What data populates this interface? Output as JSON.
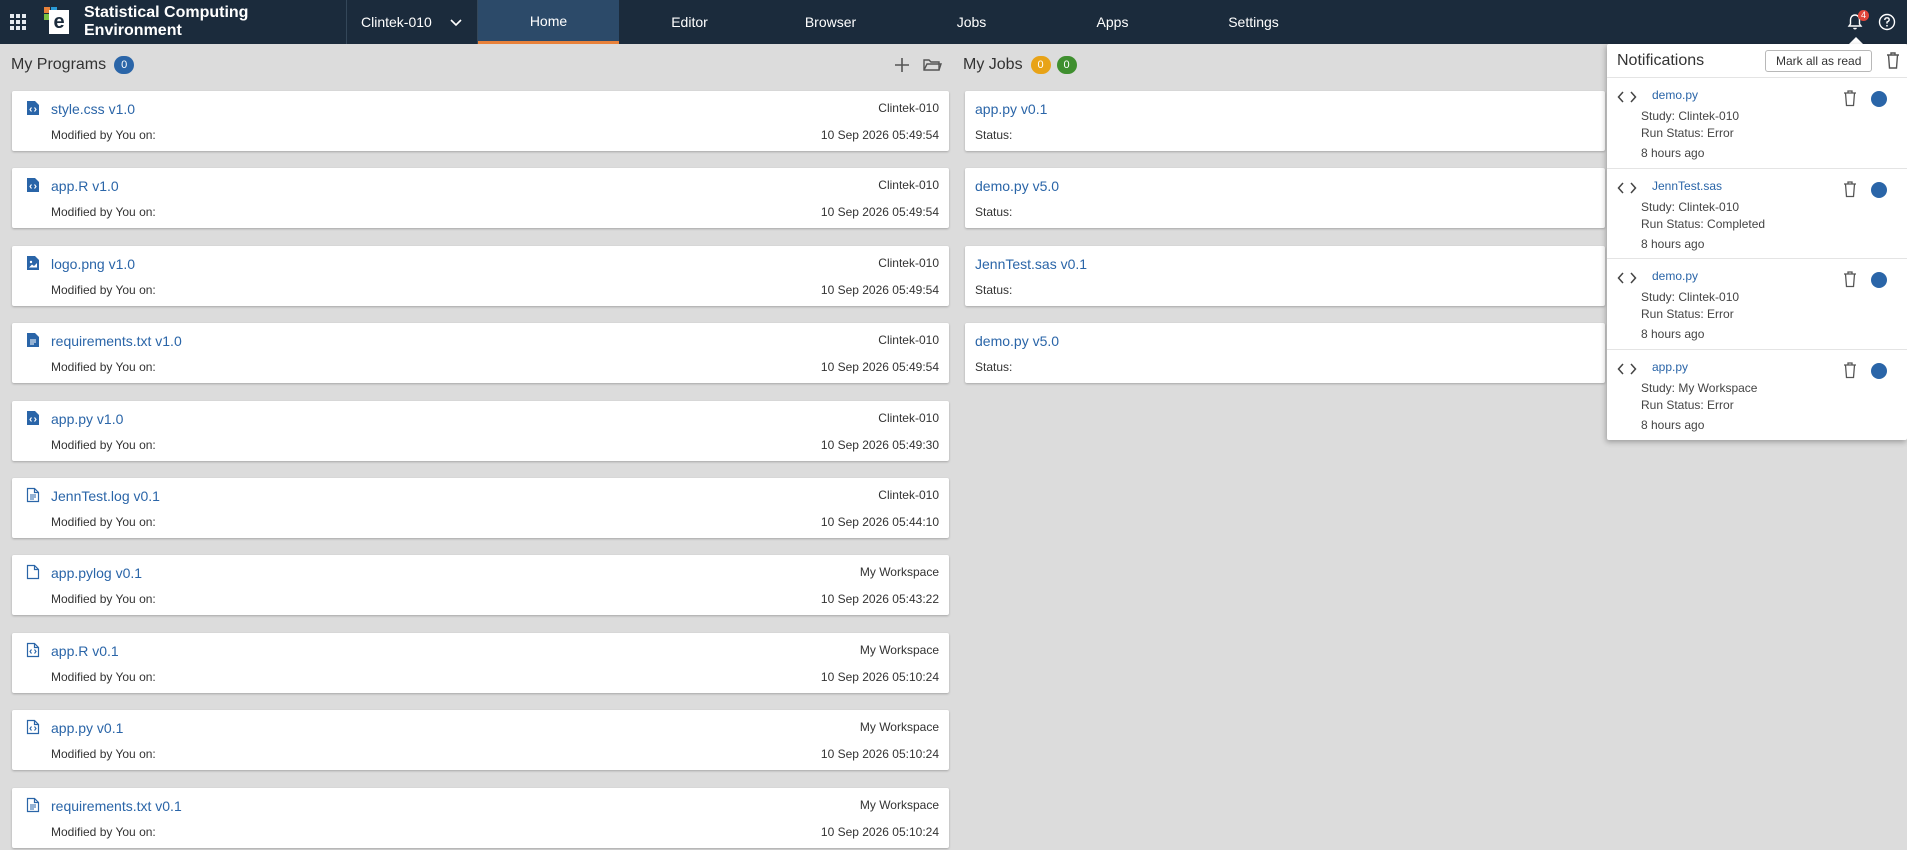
{
  "app": {
    "title": "Statistical Computing Environment",
    "logo_letter": "e",
    "study": "Clintek-010"
  },
  "nav": [
    {
      "label": "Home",
      "active": true
    },
    {
      "label": "Editor"
    },
    {
      "label": "Browser"
    },
    {
      "label": "Jobs"
    },
    {
      "label": "Apps"
    },
    {
      "label": "Settings"
    }
  ],
  "header_icons": {
    "notification_count": "4"
  },
  "programs": {
    "title": "My Programs",
    "count": "0",
    "count_color": "#2a65a8",
    "items": [
      {
        "name": "style.css v1.0",
        "icon": "code-file-icon",
        "study": "Clintek-010",
        "meta": "Modified by You on:",
        "date": "10 Sep 2026 05:49:54"
      },
      {
        "name": "app.R v1.0",
        "icon": "code-file-icon",
        "study": "Clintek-010",
        "meta": "Modified by You on:",
        "date": "10 Sep 2026 05:49:54"
      },
      {
        "name": "logo.png v1.0",
        "icon": "image-file-icon",
        "study": "Clintek-010",
        "meta": "Modified by You on:",
        "date": "10 Sep 2026 05:49:54"
      },
      {
        "name": "requirements.txt v1.0",
        "icon": "text-file-icon",
        "study": "Clintek-010",
        "meta": "Modified by You on:",
        "date": "10 Sep 2026 05:49:54"
      },
      {
        "name": "app.py v1.0",
        "icon": "code-file-icon",
        "study": "Clintek-010",
        "meta": "Modified by You on:",
        "date": "10 Sep 2026 05:49:30"
      },
      {
        "name": "JennTest.log v0.1",
        "icon": "text-file-outline-icon",
        "study": "Clintek-010",
        "meta": "Modified by You on:",
        "date": "10 Sep 2026 05:44:10"
      },
      {
        "name": "app.pylog v0.1",
        "icon": "blank-file-outline-icon",
        "study": "My Workspace",
        "meta": "Modified by You on:",
        "date": "10 Sep 2026 05:43:22"
      },
      {
        "name": "app.R v0.1",
        "icon": "code-file-outline-icon",
        "study": "My Workspace",
        "meta": "Modified by You on:",
        "date": "10 Sep 2026 05:10:24"
      },
      {
        "name": "app.py v0.1",
        "icon": "code-file-outline-icon",
        "study": "My Workspace",
        "meta": "Modified by You on:",
        "date": "10 Sep 2026 05:10:24"
      },
      {
        "name": "requirements.txt v0.1",
        "icon": "text-file-outline-icon",
        "study": "My Workspace",
        "meta": "Modified by You on:",
        "date": "10 Sep 2026 05:10:24"
      }
    ]
  },
  "jobs": {
    "title": "My Jobs",
    "count_a": "0",
    "count_a_color": "#e8a317",
    "count_b": "0",
    "count_b_color": "#3f8f2f",
    "items": [
      {
        "name": "app.py v0.1",
        "meta": "Status:"
      },
      {
        "name": "demo.py v5.0",
        "meta": "Status:"
      },
      {
        "name": "JennTest.sas v0.1",
        "meta": "Status:"
      },
      {
        "name": "demo.py v5.0",
        "meta": "Status:"
      }
    ]
  },
  "notifications": {
    "title": "Notifications",
    "mark_all_label": "Mark all as read",
    "dot_color": "#2a65a8",
    "items": [
      {
        "name": "demo.py",
        "study": "Study: Clintek-010",
        "status": "Run Status: Error",
        "time": "8 hours ago"
      },
      {
        "name": "JennTest.sas",
        "study": "Study: Clintek-010",
        "status": "Run Status: Completed",
        "time": "8 hours ago"
      },
      {
        "name": "demo.py",
        "study": "Study: Clintek-010",
        "status": "Run Status: Error",
        "time": "8 hours ago"
      },
      {
        "name": "app.py",
        "study": "Study: My Workspace",
        "status": "Run Status: Error",
        "time": "8 hours ago"
      }
    ]
  }
}
